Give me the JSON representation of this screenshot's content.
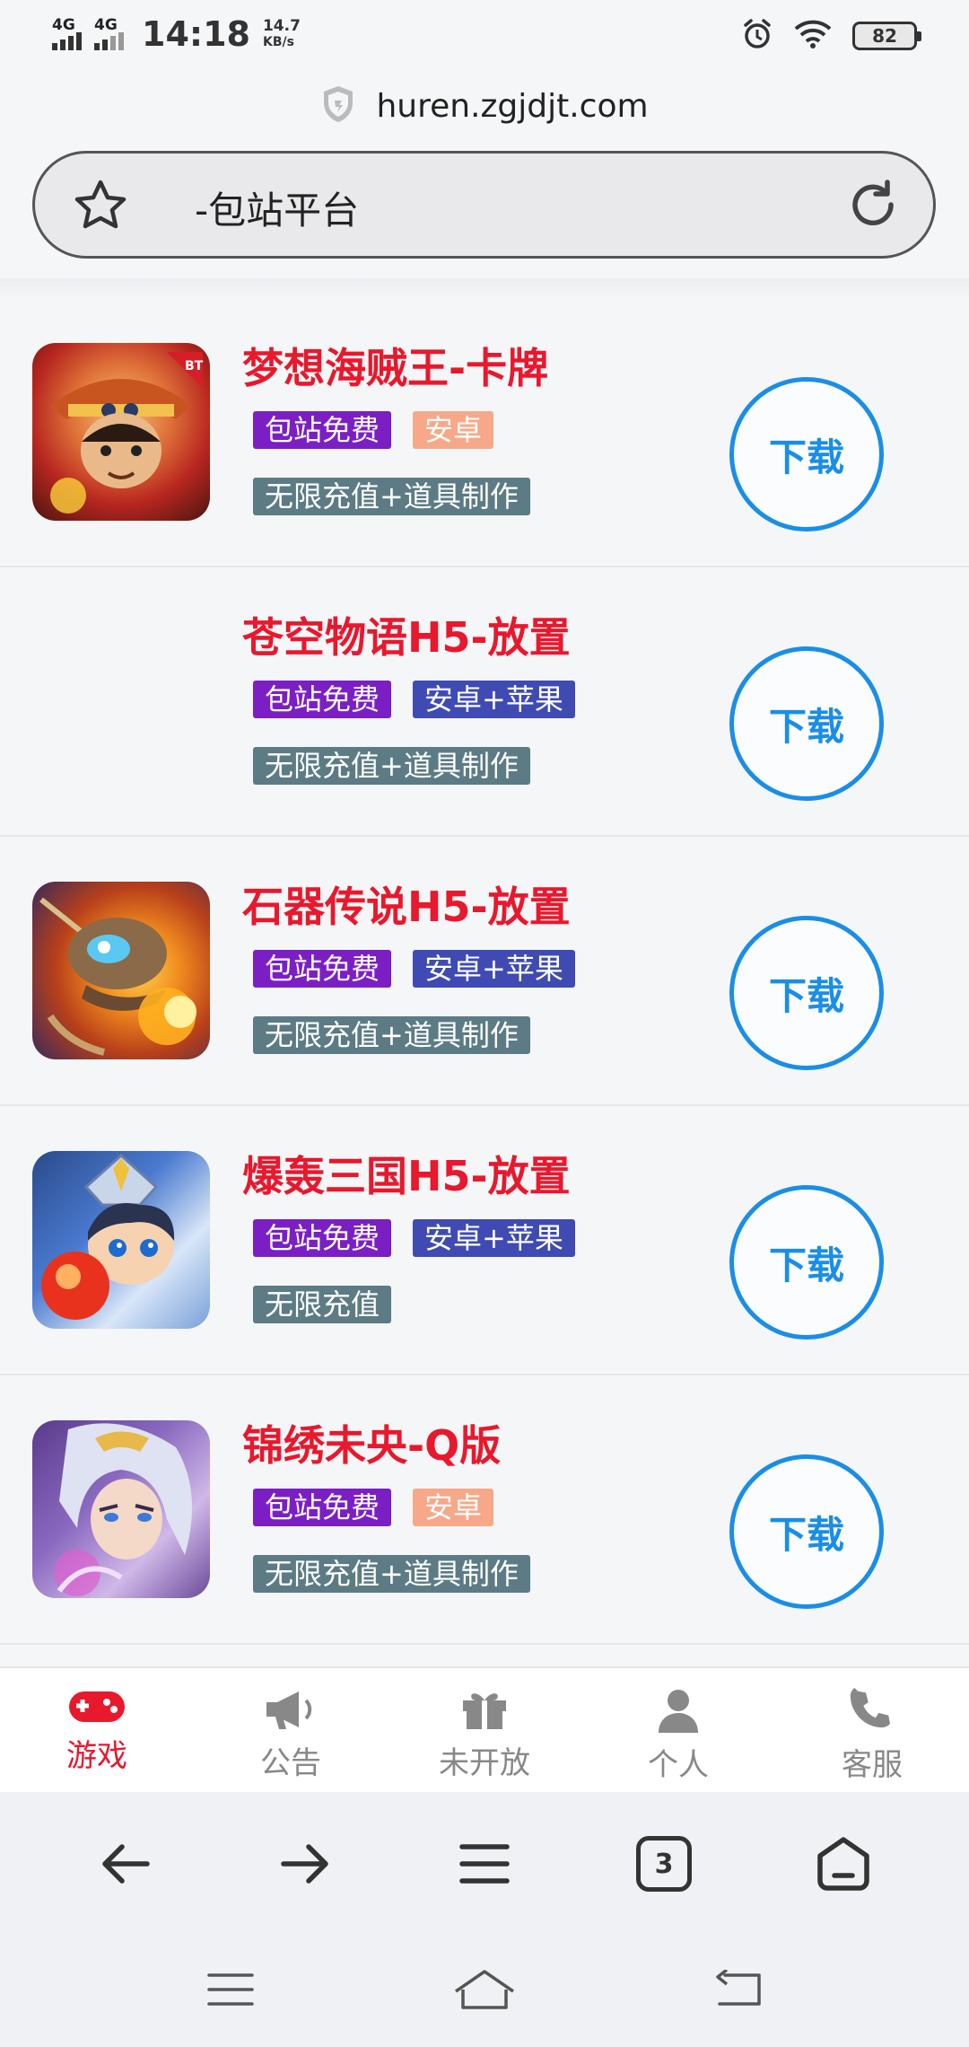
{
  "status_bar": {
    "net1": "4G",
    "net2": "4G",
    "time": "14:18",
    "speed_value": "14.7",
    "speed_unit": "KB/s",
    "battery": "82"
  },
  "browser": {
    "url": "huren.zgjdjt.com",
    "page_title": "-包站平台"
  },
  "games": [
    {
      "name": "梦想海贼王-卡牌",
      "tag_free": "包站免费",
      "platform": "安卓",
      "platform_type": "android",
      "feature": "无限充值+道具制作",
      "download": "下载",
      "has_icon": true
    },
    {
      "name": "苍空物语H5-放置",
      "tag_free": "包站免费",
      "platform": "安卓+苹果",
      "platform_type": "both",
      "feature": "无限充值+道具制作",
      "download": "下载",
      "has_icon": false
    },
    {
      "name": "石器传说H5-放置",
      "tag_free": "包站免费",
      "platform": "安卓+苹果",
      "platform_type": "both",
      "feature": "无限充值+道具制作",
      "download": "下载",
      "has_icon": true
    },
    {
      "name": "爆轰三国H5-放置",
      "tag_free": "包站免费",
      "platform": "安卓+苹果",
      "platform_type": "both",
      "feature": "无限充值",
      "download": "下载",
      "has_icon": true
    },
    {
      "name": "锦绣未央-Q版",
      "tag_free": "包站免费",
      "platform": "安卓",
      "platform_type": "android",
      "feature": "无限充值+道具制作",
      "download": "下载",
      "has_icon": true
    }
  ],
  "tabbar": {
    "tabs": [
      {
        "label": "游戏",
        "icon": "gamepad-icon",
        "active": true
      },
      {
        "label": "公告",
        "icon": "megaphone-icon",
        "active": false
      },
      {
        "label": "未开放",
        "icon": "gift-icon",
        "active": false
      },
      {
        "label": "个人",
        "icon": "person-icon",
        "active": false
      },
      {
        "label": "客服",
        "icon": "phone-icon",
        "active": false
      }
    ]
  },
  "browser_nav": {
    "tab_count": "3"
  },
  "colors": {
    "accent_red": "#e8182d",
    "download_blue": "#1a8ee6",
    "tag_purple": "#7b1fc4",
    "tag_android": "#f7a888",
    "tag_both": "#3f4bb3",
    "tag_feature": "#5c7b85"
  }
}
